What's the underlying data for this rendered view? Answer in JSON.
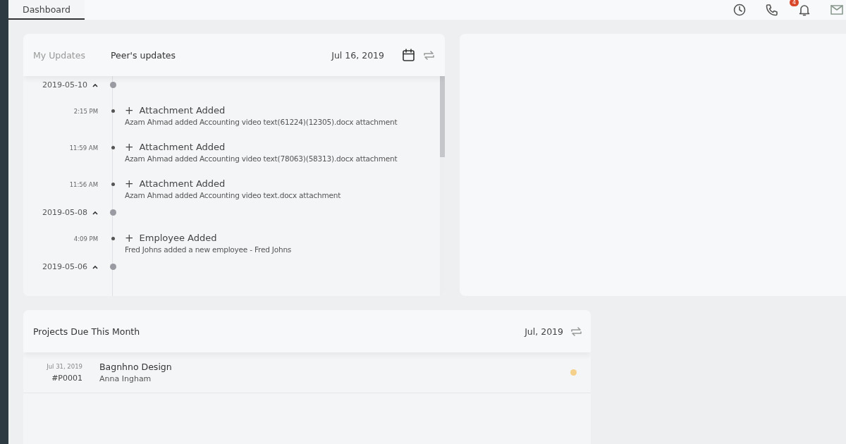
{
  "top_bar": {
    "tabs": [
      {
        "label": "Dashboard",
        "selected": true
      }
    ],
    "notification_count": "4"
  },
  "updates_card": {
    "tabs": [
      {
        "label": "My Updates",
        "selected": false
      },
      {
        "label": "Peer's updates",
        "selected": true
      }
    ],
    "date": "Jul 16, 2019",
    "groups": [
      {
        "date": "2019-05-10",
        "expanded": true,
        "events": [
          {
            "time": "2:15 PM",
            "icon": "+",
            "title": "Attachment Added",
            "detail": "Azam Ahmad added Accounting video text(61224)(12305).docx attachment"
          },
          {
            "time": "11:59 AM",
            "icon": "+",
            "title": "Attachment Added",
            "detail": "Azam Ahmad added Accounting video text(78063)(58313).docx attachment"
          },
          {
            "time": "11:56 AM",
            "icon": "+",
            "title": "Attachment Added",
            "detail": "Azam Ahmad added Accounting video text.docx attachment"
          }
        ]
      },
      {
        "date": "2019-05-08",
        "expanded": true,
        "events": [
          {
            "time": "4:09 PM",
            "icon": "+",
            "title": "Employee Added",
            "detail": "Fred Johns added a new employee - Fred Johns"
          }
        ]
      },
      {
        "date": "2019-05-06",
        "expanded": true
      }
    ]
  },
  "projects_card": {
    "title": "Projects Due This Month",
    "month": "Jul, 2019",
    "rows": [
      {
        "due": "Jul 31, 2019",
        "code": "#P0001",
        "name": "Bagnhno Design",
        "person": "Anna Ingham",
        "color": "#f5d08a"
      }
    ]
  }
}
